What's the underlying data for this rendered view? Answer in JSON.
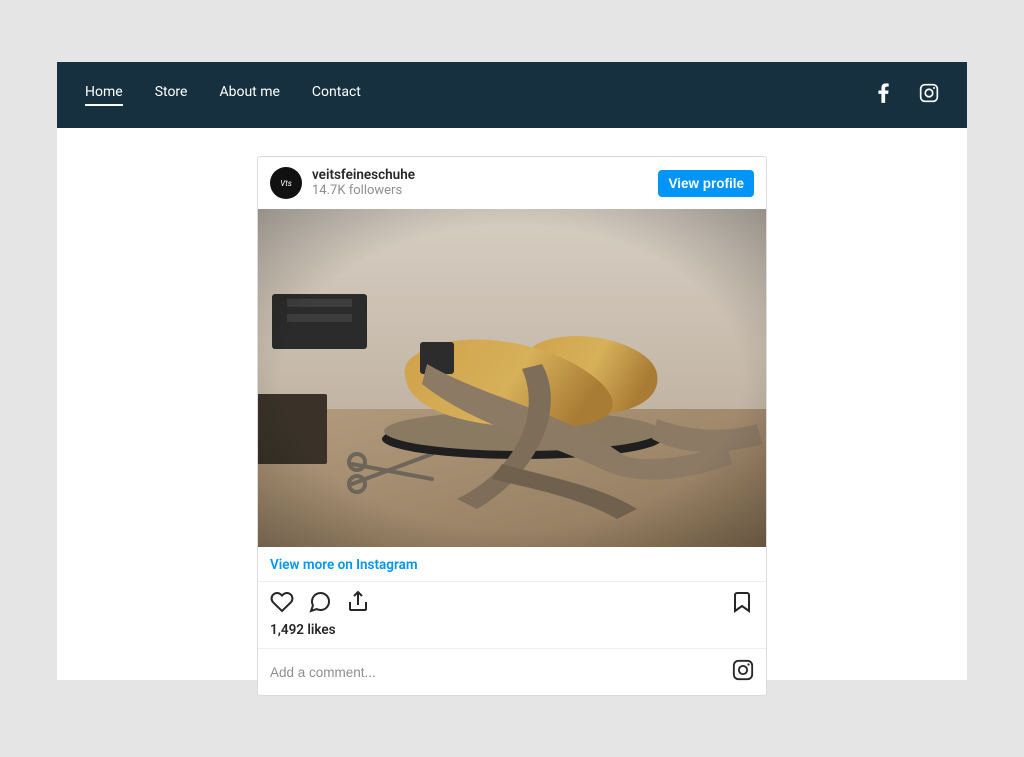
{
  "nav": {
    "items": [
      {
        "label": "Home",
        "active": true
      },
      {
        "label": "Store",
        "active": false
      },
      {
        "label": "About me",
        "active": false
      },
      {
        "label": "Contact",
        "active": false
      }
    ]
  },
  "instagram_embed": {
    "username": "veitsfeineschuhe",
    "followers_text": "14.7K followers",
    "view_profile_label": "View profile",
    "view_more_label": "View more on Instagram",
    "likes_text": "1,492 likes",
    "comment_placeholder": "Add a comment...",
    "image_alt": "Shoe lasts and leather straps on a cobbler's workbench"
  }
}
